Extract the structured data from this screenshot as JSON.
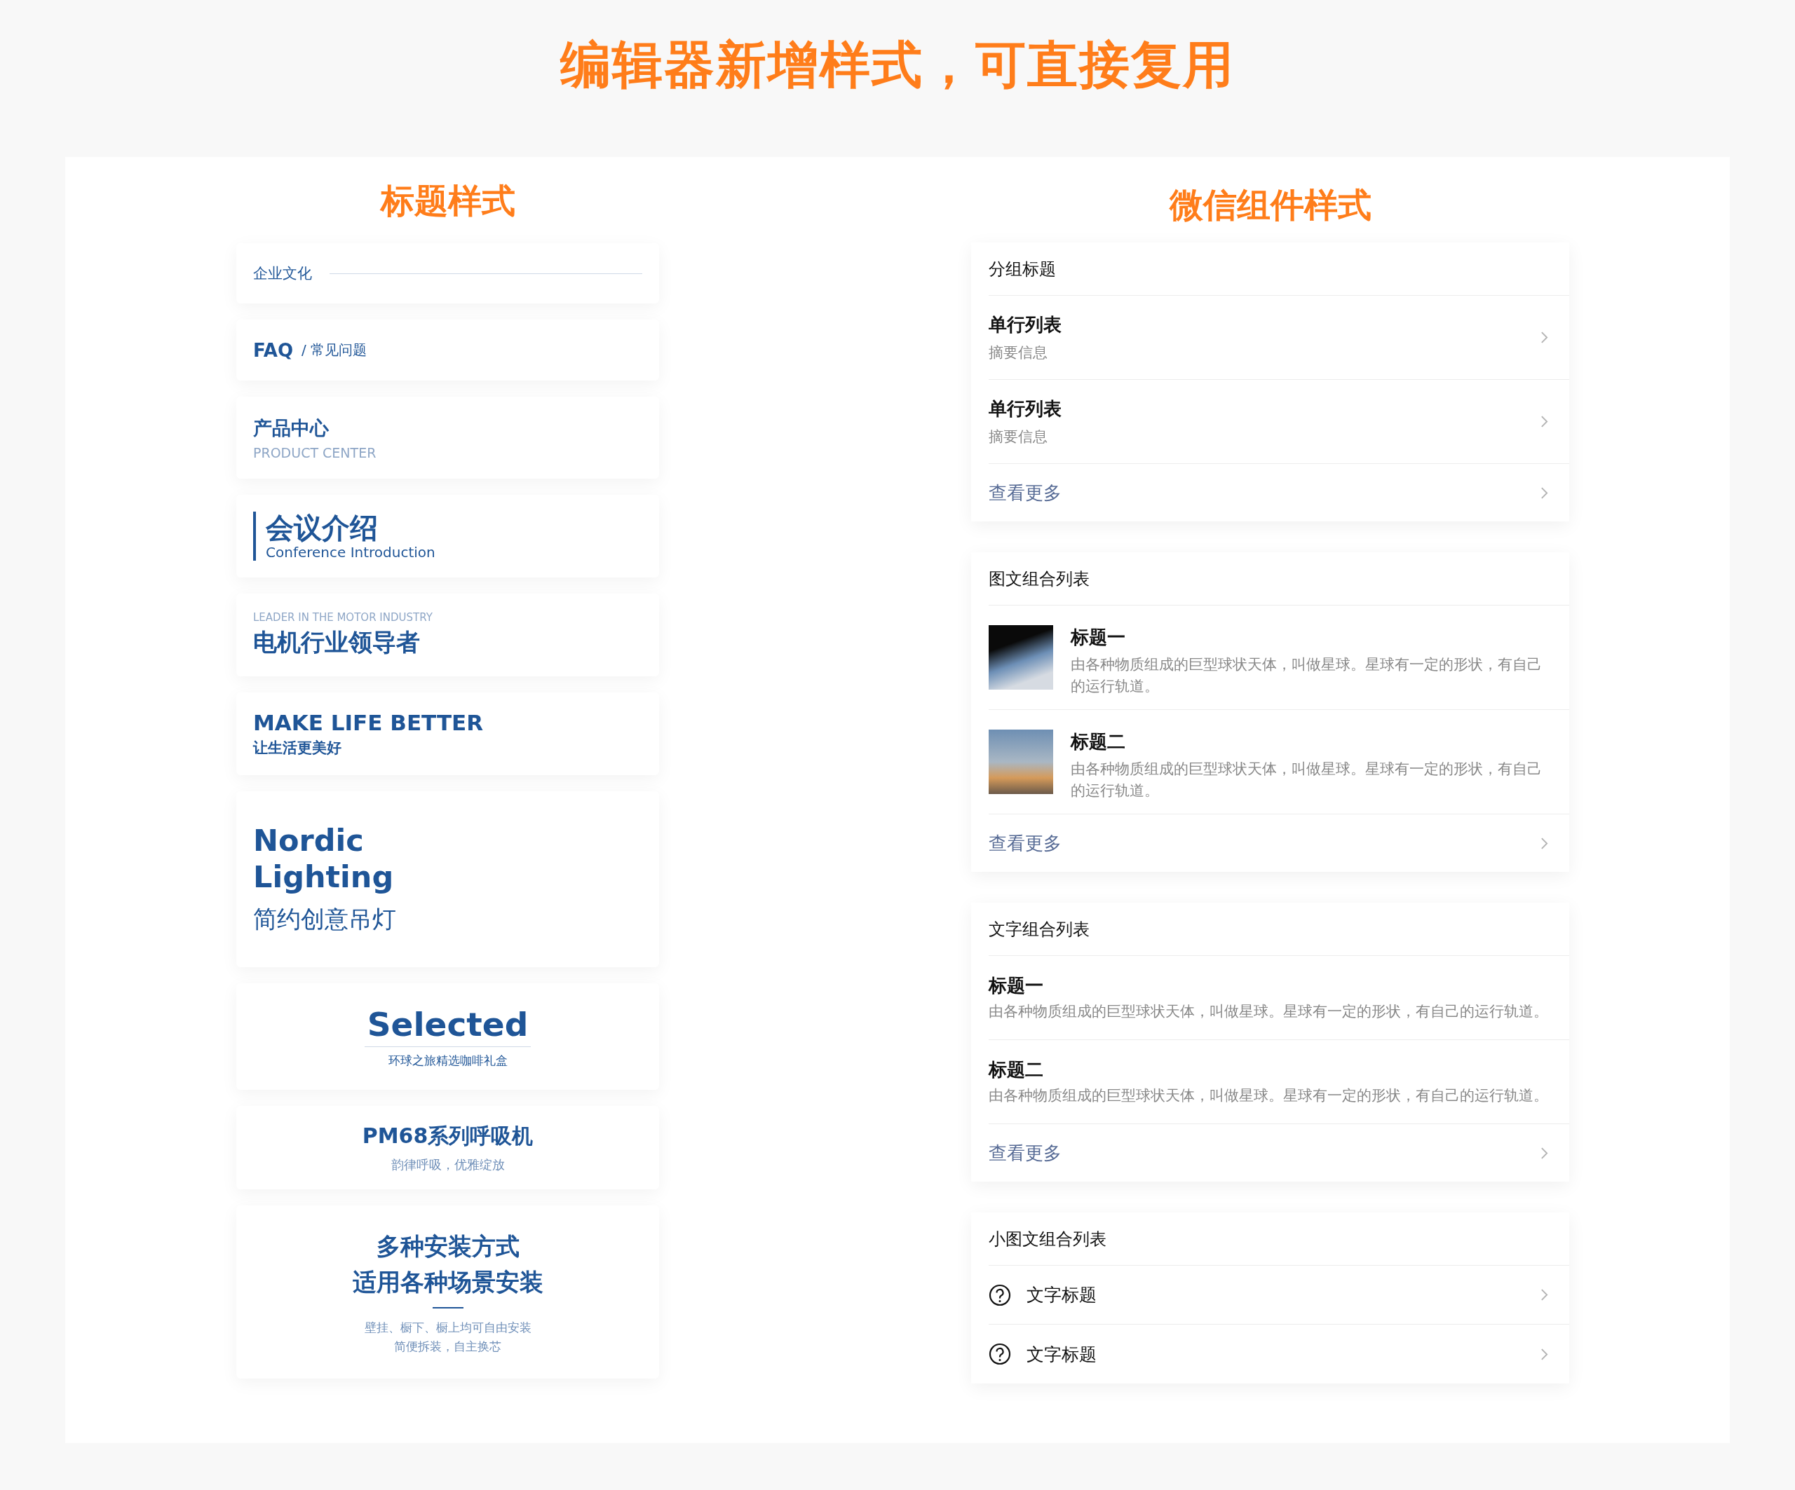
{
  "headline": "编辑器新增样式，可直接复用",
  "title_styles": {
    "heading": "标题样式",
    "cards": [
      {
        "kind": "line",
        "title": "企业文化"
      },
      {
        "kind": "faq",
        "title": "FAQ",
        "subtitle": "/ 常见问题"
      },
      {
        "kind": "stacked",
        "title": "产品中心",
        "subtitle": "PRODUCT CENTER"
      },
      {
        "kind": "bar",
        "title": "会议介绍",
        "subtitle": "Conference Introduction"
      },
      {
        "kind": "eyebrow",
        "eyebrow": "LEADER IN THE MOTOR INDUSTRY",
        "title": "电机行业领导者"
      },
      {
        "kind": "caps",
        "title": "MAKE LIFE BETTER",
        "subtitle": "让生活更美好"
      },
      {
        "kind": "big",
        "title_lines": [
          "Nordic",
          "Lighting"
        ],
        "subtitle": "简约创意吊灯"
      },
      {
        "kind": "underlined",
        "title": "Selected",
        "subtitle": "环球之旅精选咖啡礼盒"
      },
      {
        "kind": "centered",
        "title": "PM68系列呼吸机",
        "subtitle": "韵律呼吸，优雅绽放"
      },
      {
        "kind": "multi",
        "title_lines": [
          "多种安装方式",
          "适用各种场景安装"
        ],
        "lines": [
          "壁挂、橱下、橱上均可自由安装",
          "简便拆装，自主换芯"
        ]
      }
    ]
  },
  "widget_styles": {
    "heading": "微信组件样式",
    "groups": [
      {
        "kind": "single",
        "header": "分组标题",
        "items": [
          {
            "title": "单行列表",
            "summary": "摘要信息"
          },
          {
            "title": "单行列表",
            "summary": "摘要信息"
          }
        ],
        "more": "查看更多"
      },
      {
        "kind": "media",
        "header": "图文组合列表",
        "items": [
          {
            "title": "标题一",
            "summary": "由各种物质组成的巨型球状天体，叫做星球。星球有一定的形状，有自己的运行轨道。"
          },
          {
            "title": "标题二",
            "summary": "由各种物质组成的巨型球状天体，叫做星球。星球有一定的形状，有自己的运行轨道。"
          }
        ],
        "more": "查看更多"
      },
      {
        "kind": "text",
        "header": "文字组合列表",
        "items": [
          {
            "title": "标题一",
            "summary": "由各种物质组成的巨型球状天体，叫做星球。星球有一定的形状，有自己的运行轨道。"
          },
          {
            "title": "标题二",
            "summary": "由各种物质组成的巨型球状天体，叫做星球。星球有一定的形状，有自己的运行轨道。"
          }
        ],
        "more": "查看更多"
      },
      {
        "kind": "icon",
        "header": "小图文组合列表",
        "items": [
          {
            "title": "文字标题"
          },
          {
            "title": "文字标题"
          }
        ]
      }
    ]
  }
}
